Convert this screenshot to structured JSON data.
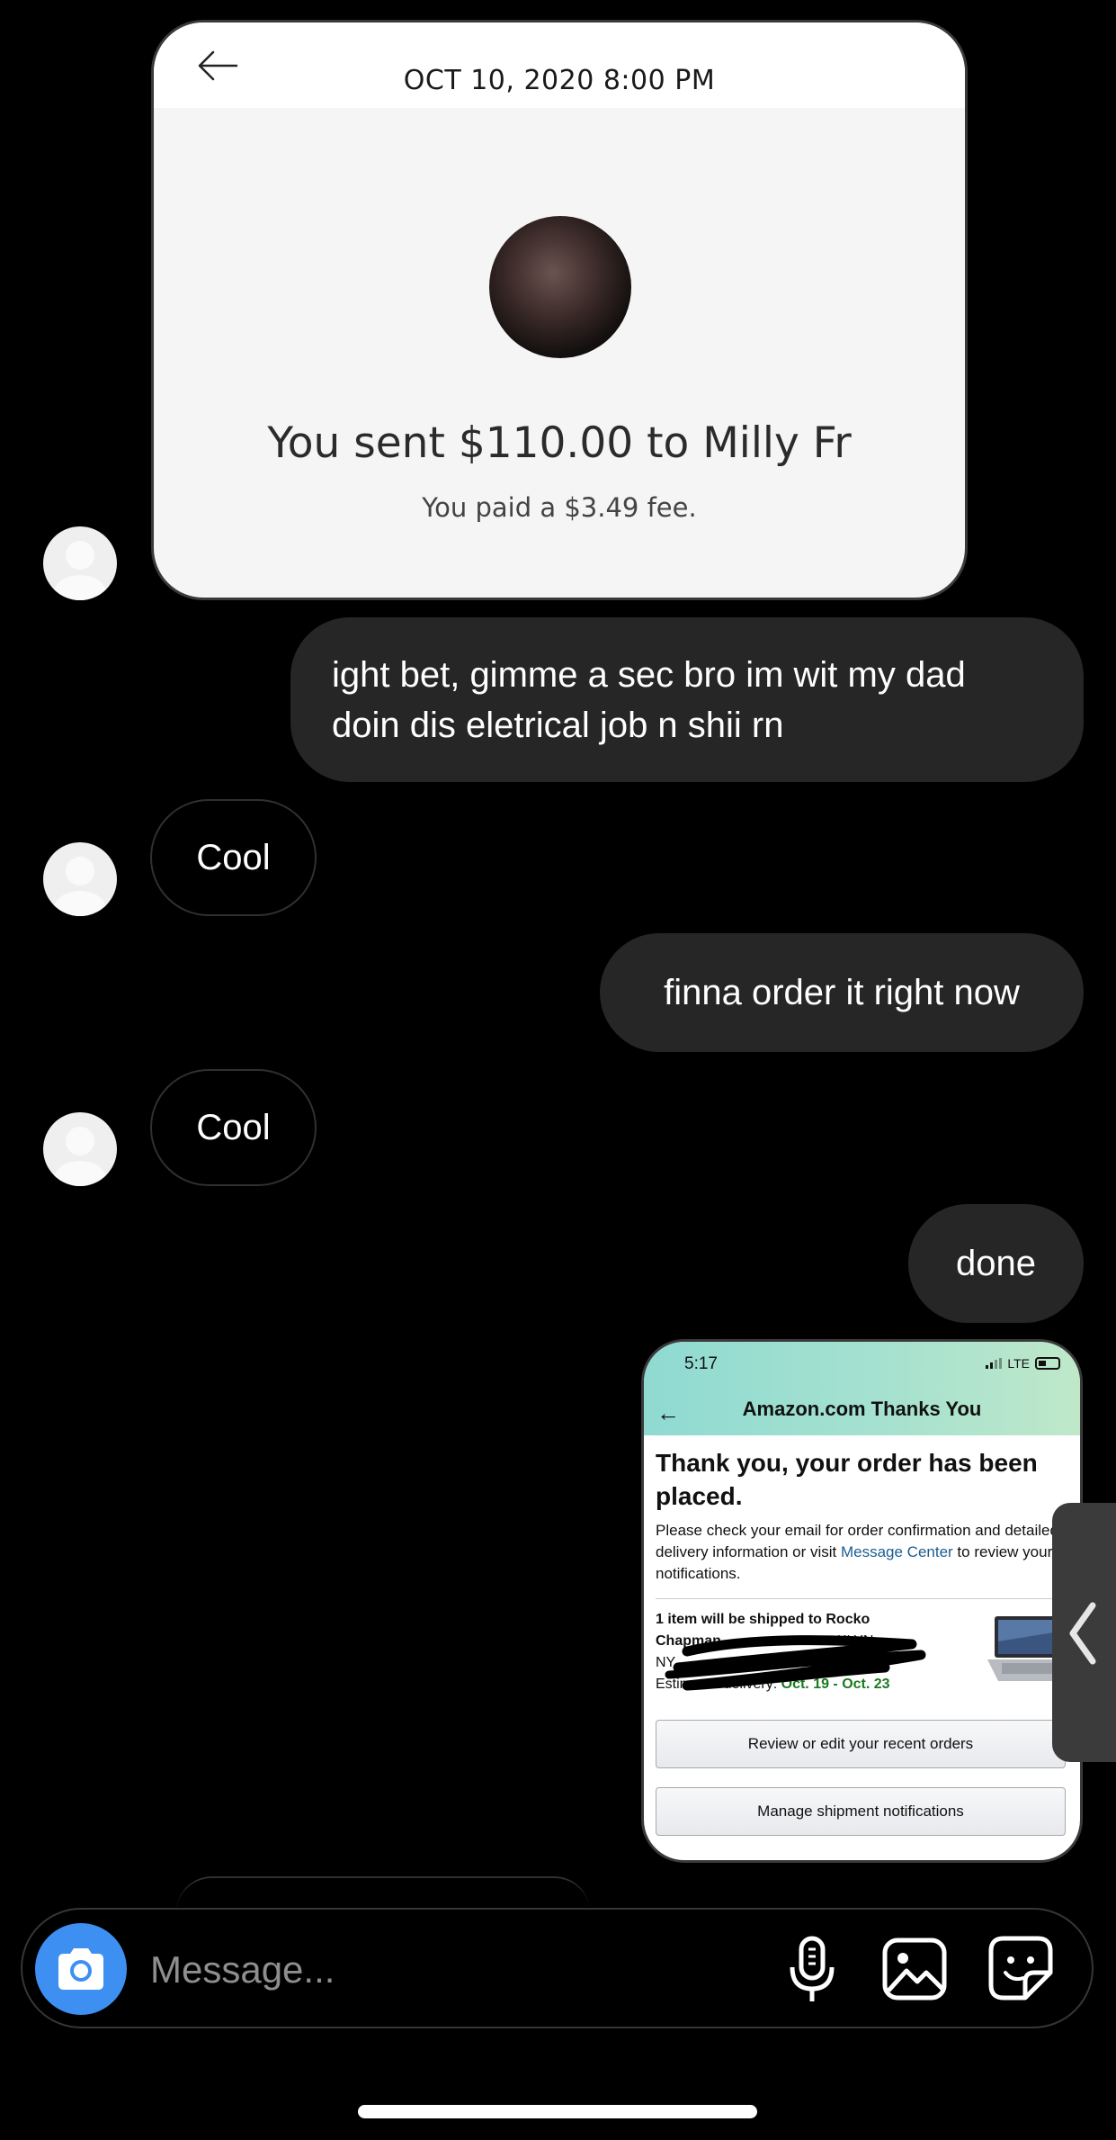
{
  "payment_card": {
    "date": "OCT 10, 2020  8:00 PM",
    "sent_text": "You sent $110.00 to Milly Fr",
    "fee_text": "You paid a $3.49 fee."
  },
  "messages": [
    {
      "id": "m1",
      "side": "sent",
      "text": "ight bet, gimme a sec bro im wit my dad doin dis eletrical job n shii rn"
    },
    {
      "id": "m2",
      "side": "received",
      "text": "Cool"
    },
    {
      "id": "m3",
      "side": "sent",
      "text": "finna order it right now"
    },
    {
      "id": "m4",
      "side": "received",
      "text": "Cool"
    },
    {
      "id": "m5",
      "side": "sent",
      "text": "done"
    }
  ],
  "amazon_card": {
    "time": "5:17",
    "network": "LTE",
    "title": "Amazon.com Thanks You",
    "heading": "Thank you, your order has been placed.",
    "body_prefix": "Please check your email for order confirmation and detailed delivery information or visit ",
    "body_link": "Message Center",
    "body_suffix": " to review your notifications.",
    "ship_line": "1 item will be shipped to Rocko",
    "ship_partial_1": "Chapman",
    "ship_partial_2": "KLYN,",
    "ship_partial_3": "NY,",
    "delivery_label": "Estimated delivery:",
    "delivery_dates": "Oct. 19 - Oct. 23",
    "button_review": "Review or edit your recent orders",
    "button_manage": "Manage shipment notifications"
  },
  "composer": {
    "placeholder": "Message..."
  },
  "icons": {
    "back": "arrow-left-icon",
    "camera": "camera-icon",
    "mic": "microphone-icon",
    "gallery": "image-icon",
    "sticker": "sticker-icon",
    "collapse": "chevron-left-icon"
  },
  "colors": {
    "background": "#000000",
    "sent_bubble": "#262626",
    "camera_button": "#3d8ff1",
    "amazon_green": "#1a7a20",
    "amazon_link": "#1b5e91"
  }
}
